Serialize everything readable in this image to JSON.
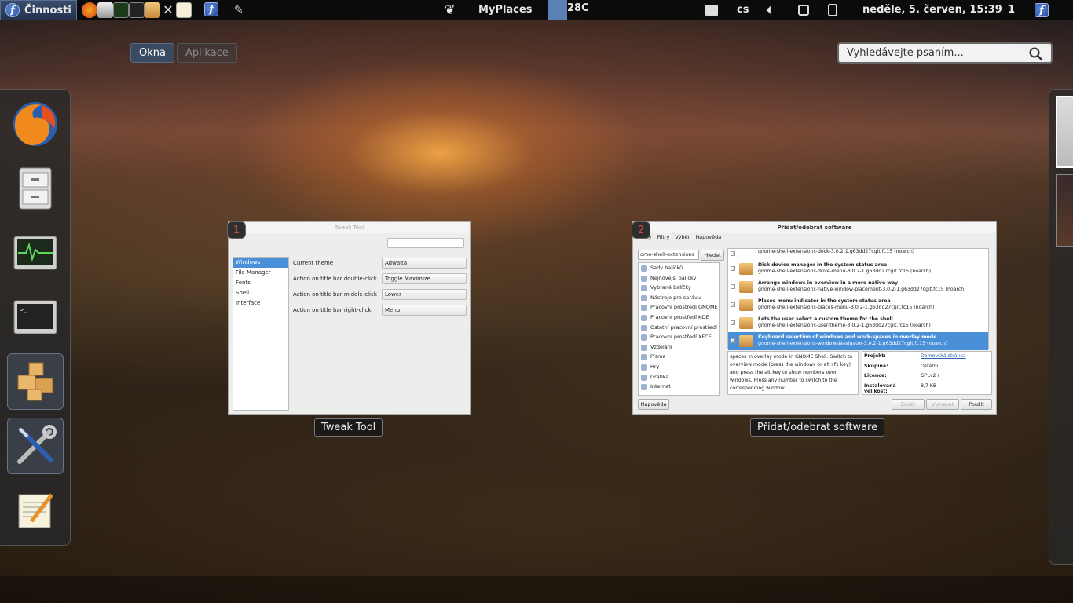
{
  "top_panel": {
    "activities_label": "Činnosti",
    "myplaces_label": "MyPlaces",
    "weather": "28C",
    "keyboard_layout": "cs",
    "clock": "neděle, 5. červen, 15:39",
    "workspace_number": "1"
  },
  "view_tabs": {
    "windows": "Okna",
    "applications": "Aplikace"
  },
  "search": {
    "placeholder": "Vyhledávejte psaním..."
  },
  "windows": [
    {
      "number": "1",
      "title": "Tweak Tool",
      "caption": "Tweak Tool",
      "sidebar": [
        "Windows",
        "File Manager",
        "Fonts",
        "Shell",
        "Interface"
      ],
      "settings": [
        {
          "label": "Current theme",
          "value": "Adwaita"
        },
        {
          "label": "Action on title bar double-click",
          "value": "Toggle Maximize"
        },
        {
          "label": "Action on title bar middle-click",
          "value": "Lower"
        },
        {
          "label": "Action on title bar right-click",
          "value": "Menu"
        }
      ]
    },
    {
      "number": "2",
      "title": "Přidat/odebrat software",
      "caption": "Přidat/odebrat software",
      "menu": [
        "Balíky",
        "Filtry",
        "Výběr",
        "Nápověda"
      ],
      "search_value": "ome-shell-extensions",
      "search_button": "Hledat",
      "groups": [
        "Sady balíčků",
        "Nejnovější balíčky",
        "Vybrané balíčky",
        "Nástroje pro správu",
        "Pracovní prostředí GNOME",
        "Pracovní prostředí KDE",
        "Ostatní pracovní prostředí",
        "Pracovní prostředí XFCE",
        "Vzdělání",
        "Písma",
        "Hry",
        "Grafika",
        "Internet"
      ],
      "packages": [
        {
          "name": "",
          "id": "gnome-shell-extensions-dock-3.0.2-1.g63dd27cgit.fc15 (noarch)",
          "checked": true
        },
        {
          "name": "Disk device manager in the system status area",
          "id": "gnome-shell-extensions-drive-menu-3.0.2-1.g63dd27cgit.fc15 (noarch)",
          "checked": true
        },
        {
          "name": "Arrange windows in overview in a more native way",
          "id": "gnome-shell-extensions-native-window-placement-3.0.2-1.g63dd27cgit.fc15 (noarch)",
          "checked": false
        },
        {
          "name": "Places menu indicator in the system status area",
          "id": "gnome-shell-extensions-places-menu-3.0.2-1.g63dd27cgit.fc15 (noarch)",
          "checked": true
        },
        {
          "name": "Lets the user select a custom theme for the shell",
          "id": "gnome-shell-extensions-user-theme-3.0.2-1.g63dd27cgit.fc15 (noarch)",
          "checked": true
        },
        {
          "name": "Keyboard selection of windows and work-spaces in overlay mode",
          "id": "gnome-shell-extensions-windowsNavigator-3.0.2-1.g63dd27cgit.fc15 (noarch)",
          "checked": true
        }
      ],
      "description": "spaces in overlay mode in GNOME Shell. Switch to overview mode (press the windows or alt+f1 key) and press the alt key to show numbers over windows. Press any number to switch to the corresponding window.",
      "details": [
        {
          "label": "Projekt:",
          "value": "Domovská stránka"
        },
        {
          "label": "Skupina:",
          "value": "Ostatní"
        },
        {
          "label": "Licence:",
          "value": "GPLv2+"
        },
        {
          "label": "Instalovaná velikost:",
          "value": "8,7 KB"
        }
      ],
      "buttons": {
        "help": "Nápověda",
        "cancel": "Zrušit",
        "clear": "Vymazat",
        "apply": "Použít"
      }
    }
  ],
  "dash": [
    "firefox-icon",
    "file-cabinet-icon",
    "system-monitor-icon",
    "terminal-icon",
    "packages-icon",
    "tools-icon",
    "text-editor-icon"
  ],
  "colors": {
    "panel": "#0b0b0b",
    "accent": "#4a90d9",
    "badge_text": "#d84a3a"
  }
}
